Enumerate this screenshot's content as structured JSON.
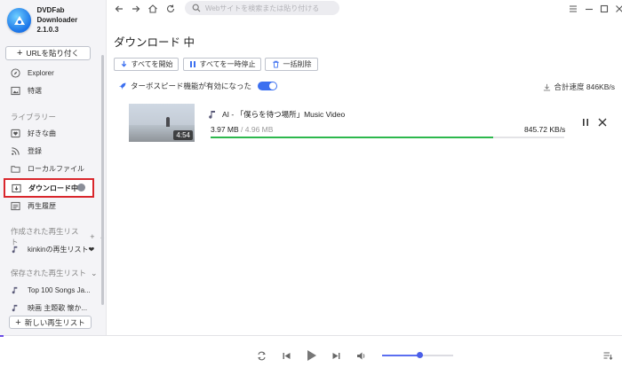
{
  "app": {
    "name": "DVDFab Downloader",
    "version": "2.1.0.3"
  },
  "sidebar": {
    "url_button": "URLを貼り付く",
    "top_items": [
      {
        "label": "Explorer",
        "icon": "compass-icon"
      },
      {
        "label": "特選",
        "icon": "picture-icon"
      }
    ],
    "library_label": "ライブラリー",
    "library_items": [
      {
        "label": "好きな曲",
        "icon": "heart-list-icon"
      },
      {
        "label": "登録",
        "icon": "rss-icon"
      },
      {
        "label": "ローカルファイル",
        "icon": "folder-icon"
      },
      {
        "label": "ダウンロード中",
        "icon": "download-box-icon",
        "active": true
      },
      {
        "label": "再生履歴",
        "icon": "history-icon"
      }
    ],
    "created_playlists_label": "作成された再生リスト",
    "created_playlists": [
      {
        "label": "kinkinの再生リスト❤"
      }
    ],
    "saved_playlists_label": "保存された再生リスト",
    "saved_playlists": [
      {
        "label": "Top 100 Songs Ja..."
      },
      {
        "label": "映画 主題歌 懐か..."
      }
    ],
    "new_playlist_button": "新しい再生リスト"
  },
  "search": {
    "placeholder": "Webサイトを検索または貼り付ける"
  },
  "main": {
    "title": "ダウンロード 中",
    "actions": {
      "start_all": "すべてを開始",
      "pause_all": "すべてを一時停止",
      "delete_all": "一括削除"
    },
    "turbo_label": "ターボスピード機能が有効になった",
    "turbo_enabled": true,
    "total_speed": "合計速度 846KB/s"
  },
  "download": {
    "title": "AI - 「僕らを待つ場所」Music Video",
    "duration": "4:54",
    "size_done": "3.97 MB",
    "size_sep": " / ",
    "size_total": "4.96 MB",
    "speed": "845.72 KB/s",
    "progress": 0.8
  },
  "player": {
    "volume": 0.5
  },
  "colors": {
    "accent": "#3b6ff0",
    "progress": "#2db84d",
    "highlight": "#d9262c"
  }
}
